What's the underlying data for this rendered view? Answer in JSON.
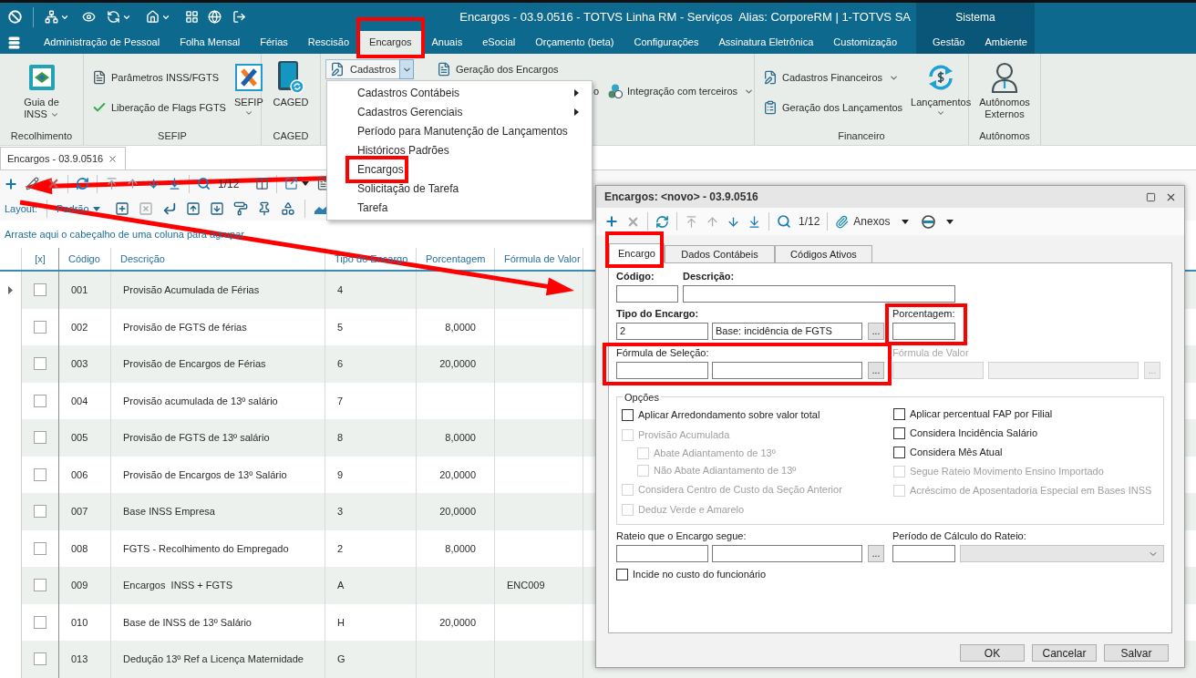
{
  "title_bar": {
    "title": "Encargos - 03.9.0516 - TOTVS Linha RM - Serviços  Alias: CorporeRM | 1-TOTVS SA",
    "context_label": "Sistema"
  },
  "ribbon_tabs": [
    {
      "label": "Administração de Pessoal",
      "selected": false,
      "annotated": false
    },
    {
      "label": "Folha Mensal",
      "selected": false,
      "annotated": false
    },
    {
      "label": "Férias",
      "selected": false,
      "annotated": false
    },
    {
      "label": "Rescisão",
      "selected": false,
      "annotated": false
    },
    {
      "label": "Encargos",
      "selected": true,
      "annotated": true
    },
    {
      "label": "Anuais",
      "selected": false,
      "annotated": false
    },
    {
      "label": "eSocial",
      "selected": false,
      "annotated": false
    },
    {
      "label": "Orçamento (beta)",
      "selected": false,
      "annotated": false
    },
    {
      "label": "Configurações",
      "selected": false,
      "annotated": false
    },
    {
      "label": "Assinatura Eletrônica",
      "selected": false,
      "annotated": false
    },
    {
      "label": "Customização",
      "selected": false,
      "annotated": false
    }
  ],
  "context_tabs": [
    {
      "label": "Gestão",
      "selected": false,
      "annotated": false
    },
    {
      "label": "Ambiente",
      "selected": false,
      "annotated": false
    }
  ],
  "ribbon_groups": [
    {
      "label": "Recolhimento",
      "items": [
        {
          "kind": "large",
          "lines": [
            "Guia de",
            "INSS"
          ],
          "dropdown": true
        }
      ]
    },
    {
      "label": "SEFIP",
      "items": [
        {
          "kind": "small",
          "label": "Parâmetros INSS/FGTS",
          "dropdown": false
        },
        {
          "kind": "small",
          "label": "Liberação de Flags FGTS",
          "dropdown": false
        },
        {
          "kind": "large",
          "lines": [
            "SEFIP"
          ],
          "dropdown": true
        }
      ]
    },
    {
      "label": "CAGED",
      "items": [
        {
          "kind": "large",
          "lines": [
            "CAGED"
          ],
          "dropdown": false
        }
      ]
    },
    {
      "items": [
        {
          "kind": "split",
          "label": "Cadastros",
          "open": true
        },
        {
          "kind": "small",
          "label": "Geração dos Encargos",
          "dropdown": false
        },
        {
          "kind": "fragment",
          "label": "o"
        },
        {
          "kind": "small",
          "label": "Integração com terceiros",
          "dropdown": true
        }
      ]
    },
    {
      "label": "Financeiro",
      "items": [
        {
          "kind": "small",
          "label": "Cadastros Financeiros",
          "dropdown": true
        },
        {
          "kind": "small",
          "label": "Geração dos Lançamentos",
          "dropdown": false
        },
        {
          "kind": "large",
          "lines": [
            "Lançamentos"
          ],
          "dropdown": true
        }
      ]
    },
    {
      "label": "Autônomos",
      "items": [
        {
          "kind": "large",
          "lines": [
            "Autônomos",
            "Externos"
          ],
          "dropdown": false
        }
      ]
    }
  ],
  "cadastros_menu": {
    "items": [
      {
        "label": "Cadastros Contábeis",
        "submenu": true,
        "annotated": false
      },
      {
        "label": "Cadastros Gerenciais",
        "submenu": true,
        "annotated": false
      },
      {
        "label": "Período para Manutenção de Lançamentos",
        "submenu": false,
        "annotated": false
      },
      {
        "label": "Históricos Padrões",
        "submenu": false,
        "annotated": false
      },
      {
        "label": "Encargos",
        "submenu": false,
        "annotated": true
      },
      {
        "label": "Solicitação de Tarefa",
        "submenu": false,
        "annotated": false
      },
      {
        "label": "Tarefa",
        "submenu": false,
        "annotated": false
      }
    ]
  },
  "document_tabs": [
    {
      "label": "Encargos - 03.9.0516",
      "selected": true
    }
  ],
  "toolbar": {
    "counter": "1/12"
  },
  "layout_bar": {
    "label": "Layout:",
    "value": "Padrão"
  },
  "grid": {
    "group_hint": "Arraste aqui o cabeçalho de uma coluna para agrupar",
    "columns": [
      "[x]",
      "Código",
      "Descrição",
      "Tipo do Encargo",
      "Porcentagem",
      "Fórmula de Valor"
    ],
    "rows": [
      {
        "current": true,
        "checked": false,
        "codigo": "001",
        "descricao": "Provisão Acumulada de Férias",
        "tipo": "4"
      },
      {
        "current": false,
        "checked": false,
        "codigo": "002",
        "descricao": "Provisão de FGTS de férias",
        "tipo": "5",
        "porcentagem": "8,0000"
      },
      {
        "current": false,
        "checked": false,
        "codigo": "003",
        "descricao": "Provisão de Encargos de Férias",
        "tipo": "6",
        "porcentagem": "20,0000"
      },
      {
        "current": false,
        "checked": false,
        "codigo": "004",
        "descricao": "Provisão acumulada de 13º salário",
        "tipo": "7"
      },
      {
        "current": false,
        "checked": false,
        "codigo": "005",
        "descricao": "Provisão de FGTS de 13º salário",
        "tipo": "8",
        "porcentagem": "8,0000"
      },
      {
        "current": false,
        "checked": false,
        "codigo": "006",
        "descricao": "Provisão de Encargos de 13º Salário",
        "tipo": "9",
        "porcentagem": "20,0000"
      },
      {
        "current": false,
        "checked": false,
        "codigo": "007",
        "descricao": "Base INSS Empresa",
        "tipo": "3",
        "porcentagem": "20,0000"
      },
      {
        "current": false,
        "checked": false,
        "codigo": "008",
        "descricao": "FGTS - Recolhimento do Empregado",
        "tipo": "2",
        "porcentagem": "8,0000"
      },
      {
        "current": false,
        "checked": false,
        "codigo": "009",
        "descricao": "Encargos  INSS + FGTS",
        "tipo": "A",
        "formula": "ENC009"
      },
      {
        "current": false,
        "checked": false,
        "codigo": "010",
        "descricao": "Base de INSS de 13º Salário",
        "tipo": "H",
        "porcentagem": "20,0000"
      },
      {
        "current": false,
        "checked": false,
        "codigo": "013",
        "descricao": "Dedução 13º Ref a Licença Maternidade",
        "tipo": "G"
      }
    ]
  },
  "dialog": {
    "title": "Encargos: <novo> - 03.9.0516",
    "counter": "1/12",
    "attachments": "Anexos",
    "tabs": [
      {
        "label": "Encargo",
        "selected": true,
        "annotated": true
      },
      {
        "label": "Dados Contábeis",
        "selected": false,
        "annotated": false
      },
      {
        "label": "Códigos Ativos",
        "selected": false,
        "annotated": false
      }
    ],
    "form": {
      "codigo": {
        "label": "Código:"
      },
      "descricao": {
        "label": "Descrição:"
      },
      "tipo": {
        "label": "Tipo do Encargo:",
        "code": "2",
        "name": "Base: incidência de FGTS",
        "browse": "..."
      },
      "porcentagem": {
        "label": "Porcentagem:",
        "annotated": true
      },
      "formula_selecao": {
        "label": "Fórmula de Seleção:",
        "browse": "...",
        "annotated": true
      },
      "formula_valor": {
        "label": "Fórmula de Valor",
        "disabled": true,
        "browse": "..."
      },
      "opcoes": {
        "title": "Opções",
        "left": [
          {
            "label": "Aplicar Arredondamento sobre valor total",
            "checked": false,
            "disabled": false
          },
          {
            "label": "Provisão Acumulada",
            "checked": false,
            "disabled": true,
            "children": [
              {
                "label": "Abate Adiantamento de 13º",
                "checked": false,
                "disabled": true
              },
              {
                "label": "Não Abate Adiantamento de 13º",
                "checked": false,
                "disabled": true
              }
            ]
          },
          {
            "label": "Considera Centro de Custo da Seção Anterior",
            "checked": false,
            "disabled": true
          },
          {
            "label": "Deduz Verde e Amarelo",
            "checked": false,
            "disabled": true
          }
        ],
        "right": [
          {
            "label": "Aplicar percentual FAP por Filial",
            "checked": false,
            "disabled": false
          },
          {
            "label": "Considera Incidência Salário",
            "checked": false,
            "disabled": false
          },
          {
            "label": "Considera Mês Atual",
            "checked": false,
            "disabled": false
          },
          {
            "label": "Segue Rateio Movimento Ensino Importado",
            "checked": false,
            "disabled": true
          },
          {
            "label": "Acréscimo de Aposentadoria Especial em Bases INSS",
            "checked": false,
            "disabled": true
          }
        ]
      },
      "rateio": {
        "label": "Rateio que o Encargo segue:",
        "browse": "..."
      },
      "periodo": {
        "label": "Período de Cálculo do Rateio:",
        "select_disabled": true
      },
      "incide": {
        "label": "Incide no custo do funcionário",
        "checked": false,
        "disabled": false
      }
    },
    "buttons": [
      "OK",
      "Cancelar",
      "Salvar"
    ]
  }
}
